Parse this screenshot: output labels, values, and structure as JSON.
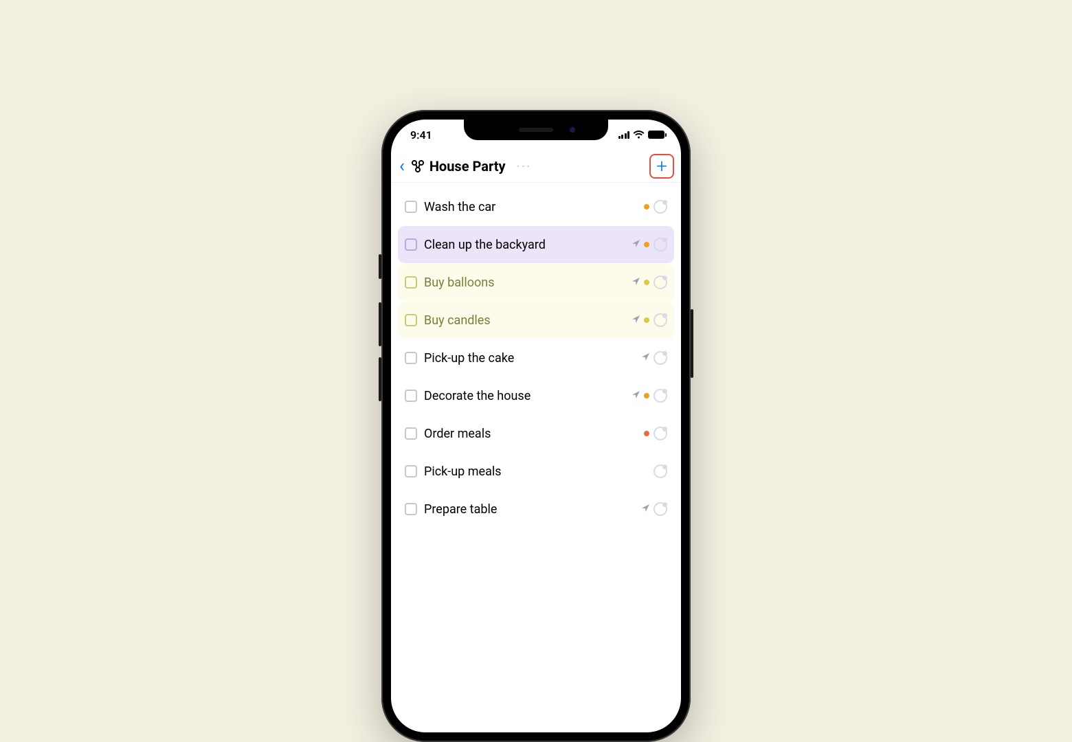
{
  "status": {
    "time": "9:41"
  },
  "nav": {
    "title": "House Party",
    "back_label": "‹",
    "more_label": "···",
    "add_label": "+"
  },
  "tasks": [
    {
      "title": "Wash the car",
      "highlight": "",
      "location": false,
      "dot": "orange",
      "avatar": true
    },
    {
      "title": "Clean up the backyard",
      "highlight": "purple",
      "location": true,
      "dot": "orange",
      "avatar": true
    },
    {
      "title": "Buy balloons",
      "highlight": "yellow",
      "location": true,
      "dot": "yellow",
      "avatar": true
    },
    {
      "title": "Buy candles",
      "highlight": "yellow",
      "location": true,
      "dot": "yellow",
      "avatar": true
    },
    {
      "title": "Pick-up the cake",
      "highlight": "",
      "location": true,
      "dot": "",
      "avatar": true
    },
    {
      "title": "Decorate the house",
      "highlight": "",
      "location": true,
      "dot": "orange",
      "avatar": true
    },
    {
      "title": "Order meals",
      "highlight": "",
      "location": false,
      "dot": "red",
      "avatar": true
    },
    {
      "title": "Pick-up meals",
      "highlight": "",
      "location": false,
      "dot": "",
      "avatar": true
    },
    {
      "title": "Prepare table",
      "highlight": "",
      "location": true,
      "dot": "",
      "avatar": true
    }
  ]
}
